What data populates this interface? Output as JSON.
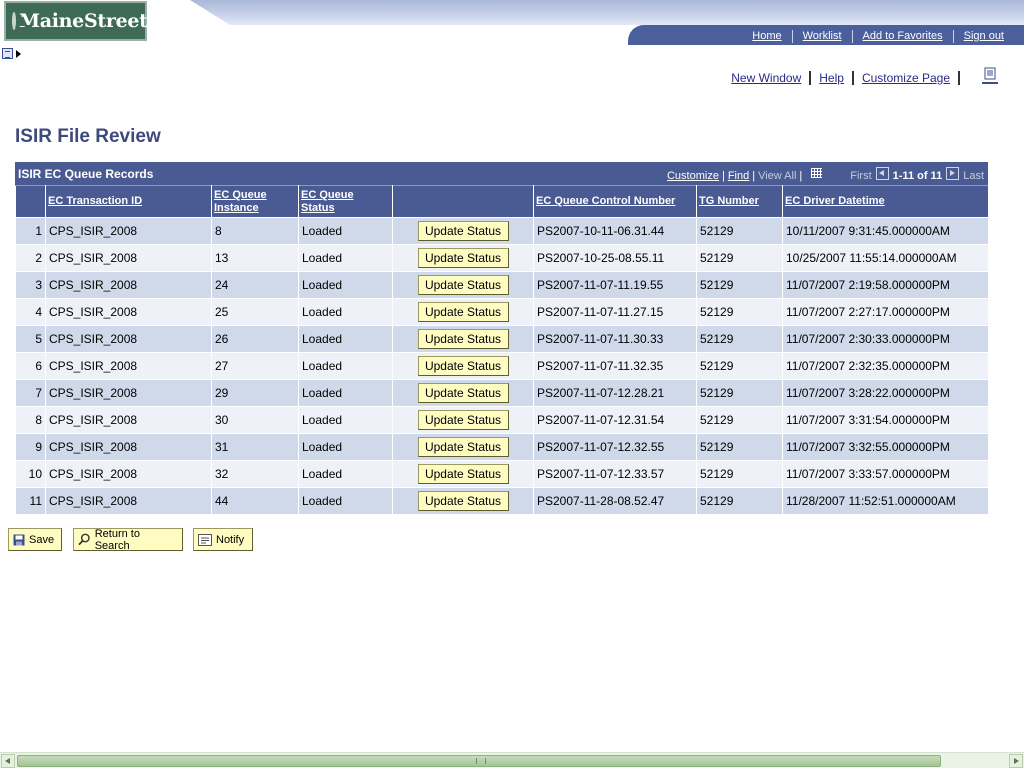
{
  "header": {
    "logo_text": "MaineStreet",
    "nav": [
      "Home",
      "Worklist",
      "Add to Favorites",
      "Sign out"
    ]
  },
  "page_links": {
    "new_window": "New Window",
    "help": "Help",
    "customize_page": "Customize Page",
    "http_icon": "http-icon"
  },
  "page_title": "ISIR File Review",
  "grid": {
    "title": "ISIR EC Queue Records",
    "tools": {
      "customize": "Customize",
      "find": "Find",
      "view_all": "View All",
      "first": "First",
      "range": "1-11 of 11",
      "last": "Last"
    },
    "columns": [
      "EC Transaction ID",
      "EC Queue Instance",
      "EC Queue Status",
      "",
      "EC Queue Control Number",
      "TG Number",
      "EC Driver Datetime"
    ],
    "button_label": "Update Status",
    "rows": [
      {
        "n": "1",
        "txn": "CPS_ISIR_2008",
        "inst": "8",
        "status": "Loaded",
        "ctrl": "PS2007-10-11-06.31.44",
        "tg": "52129",
        "dt": "10/11/2007  9:31:45.000000AM"
      },
      {
        "n": "2",
        "txn": "CPS_ISIR_2008",
        "inst": "13",
        "status": "Loaded",
        "ctrl": "PS2007-10-25-08.55.11",
        "tg": "52129",
        "dt": "10/25/2007 11:55:14.000000AM"
      },
      {
        "n": "3",
        "txn": "CPS_ISIR_2008",
        "inst": "24",
        "status": "Loaded",
        "ctrl": "PS2007-11-07-11.19.55",
        "tg": "52129",
        "dt": "11/07/2007  2:19:58.000000PM"
      },
      {
        "n": "4",
        "txn": "CPS_ISIR_2008",
        "inst": "25",
        "status": "Loaded",
        "ctrl": "PS2007-11-07-11.27.15",
        "tg": "52129",
        "dt": "11/07/2007  2:27:17.000000PM"
      },
      {
        "n": "5",
        "txn": "CPS_ISIR_2008",
        "inst": "26",
        "status": "Loaded",
        "ctrl": "PS2007-11-07-11.30.33",
        "tg": "52129",
        "dt": "11/07/2007  2:30:33.000000PM"
      },
      {
        "n": "6",
        "txn": "CPS_ISIR_2008",
        "inst": "27",
        "status": "Loaded",
        "ctrl": "PS2007-11-07-11.32.35",
        "tg": "52129",
        "dt": "11/07/2007  2:32:35.000000PM"
      },
      {
        "n": "7",
        "txn": "CPS_ISIR_2008",
        "inst": "29",
        "status": "Loaded",
        "ctrl": "PS2007-11-07-12.28.21",
        "tg": "52129",
        "dt": "11/07/2007  3:28:22.000000PM"
      },
      {
        "n": "8",
        "txn": "CPS_ISIR_2008",
        "inst": "30",
        "status": "Loaded",
        "ctrl": "PS2007-11-07-12.31.54",
        "tg": "52129",
        "dt": "11/07/2007  3:31:54.000000PM"
      },
      {
        "n": "9",
        "txn": "CPS_ISIR_2008",
        "inst": "31",
        "status": "Loaded",
        "ctrl": "PS2007-11-07-12.32.55",
        "tg": "52129",
        "dt": "11/07/2007  3:32:55.000000PM"
      },
      {
        "n": "10",
        "txn": "CPS_ISIR_2008",
        "inst": "32",
        "status": "Loaded",
        "ctrl": "PS2007-11-07-12.33.57",
        "tg": "52129",
        "dt": "11/07/2007  3:33:57.000000PM"
      },
      {
        "n": "11",
        "txn": "CPS_ISIR_2008",
        "inst": "44",
        "status": "Loaded",
        "ctrl": "PS2007-11-28-08.52.47",
        "tg": "52129",
        "dt": "11/28/2007 11:52:51.000000AM"
      }
    ]
  },
  "toolbar": {
    "save": "Save",
    "return_to_search": "Return to Search",
    "notify": "Notify"
  },
  "colors": {
    "header_blue": "#4a5b93",
    "row_odd": "#cfd9ea",
    "row_even": "#eef1f8",
    "button_yellow": "#fefcc0",
    "title_color": "#3c4a7c"
  }
}
